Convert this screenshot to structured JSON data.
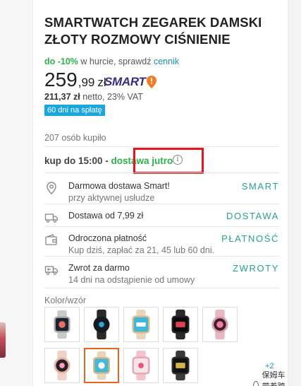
{
  "product": {
    "title": "SMARTWATCH ZEGAREK DAMSKI ZŁOTY ROZMOWY CIŚNIENIE"
  },
  "promo": {
    "discount": "do -10%",
    "text": "w hurcie, sprawdź",
    "link": "cennik"
  },
  "price": {
    "integer": "259",
    "decimal": ",99",
    "currency": "zł",
    "smart_label": "SMART",
    "netto_value": "211,37 zł",
    "netto_suffix": "netto, 23% VAT",
    "installments_badge": "60 dni na spłatę"
  },
  "purchases": "207 osób kupiło",
  "delivery_time": {
    "prefix": "kup do 15:00 -",
    "highlight": "dostawa jutro"
  },
  "benefits": [
    {
      "line1": "Darmowa dostawa Smart!",
      "line2": "przy aktywnej usłudze",
      "action": "SMART",
      "icon": "location-pin-icon"
    },
    {
      "line1": "Dostawa od 7,99 zł",
      "line2": "",
      "action": "DOSTAWA",
      "icon": "truck-icon"
    },
    {
      "line1": "Odroczona płatność",
      "line2": "Kup dziś, zapłać za 21, 45 lub 60 dni.",
      "action": "PŁATNOŚĆ",
      "icon": "wallet-icon"
    },
    {
      "line1": "Zwrot za darmo",
      "line2": "14 dni na odstąpienie od umowy",
      "action": "ZWROTY",
      "icon": "return-truck-icon"
    }
  ],
  "variants": {
    "label": "Kolor/wzór",
    "more": "+2"
  },
  "watermark": "保姆车带着跨境",
  "colors": {
    "green": "#2db34a",
    "link": "#1a8fb5",
    "teal_action": "#2aa08f",
    "badge": "#1ba6e0",
    "highlight_box": "#e8151c",
    "selected_border": "#e8631c",
    "smart_purple": "#3c2a7d",
    "smart_orange": "#f47b20"
  }
}
